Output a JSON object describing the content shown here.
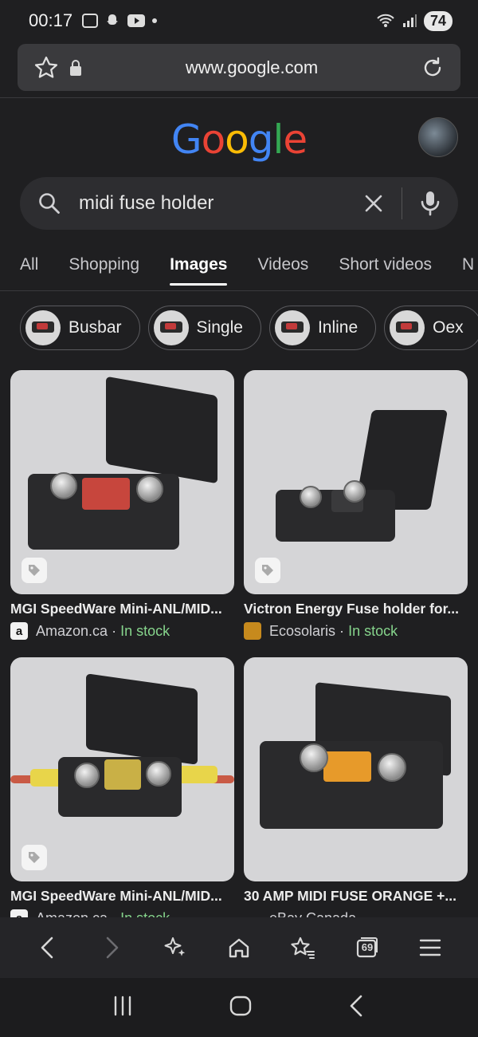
{
  "status": {
    "time": "00:17",
    "battery": "74"
  },
  "urlbar": {
    "url": "www.google.com"
  },
  "logo": {
    "letters": [
      "G",
      "o",
      "o",
      "g",
      "l",
      "e"
    ],
    "colors": [
      "#4285f4",
      "#ea4335",
      "#fbbc05",
      "#4285f4",
      "#34a853",
      "#ea4335"
    ]
  },
  "search": {
    "query": "midi fuse holder"
  },
  "tabs": [
    {
      "label": "All"
    },
    {
      "label": "Shopping"
    },
    {
      "label": "Images",
      "active": true
    },
    {
      "label": "Videos"
    },
    {
      "label": "Short videos"
    },
    {
      "label": "N"
    }
  ],
  "chips": [
    {
      "label": "Busbar"
    },
    {
      "label": "Single"
    },
    {
      "label": "Inline"
    },
    {
      "label": "Oex"
    }
  ],
  "results": [
    {
      "title": "MGI SpeedWare Mini-ANL/MID...",
      "source": "Amazon.ca",
      "sep": "·",
      "stock": "In stock",
      "logo": "a"
    },
    {
      "title": "Victron Energy Fuse holder for...",
      "source": "Ecosolaris",
      "sep": "·",
      "stock": "In stock",
      "logo": ""
    },
    {
      "title": "MGI SpeedWare Mini-ANL/MID...",
      "source": "Amazon.ca",
      "sep": "·",
      "stock": "In stock",
      "logo": "a"
    },
    {
      "title": "30 AMP MIDI FUSE ORANGE +...",
      "source": "eBay Canada",
      "sep": "",
      "stock": "",
      "logo": ""
    }
  ],
  "toolbar": {
    "tabs_count": "69"
  }
}
